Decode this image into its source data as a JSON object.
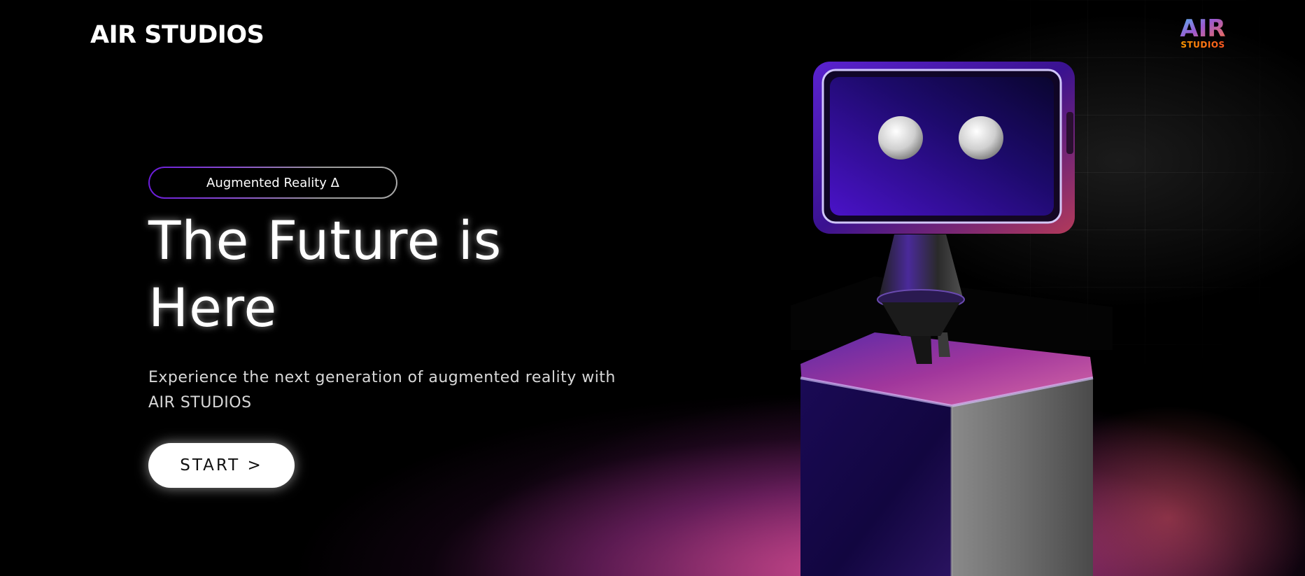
{
  "header": {
    "brand": "AIR STUDIOS",
    "logo": {
      "top_text": "AIR",
      "bottom_text": "STUDIOS"
    }
  },
  "hero": {
    "badge": "Augmented Reality Δ",
    "headline": "The Future is Here",
    "subtitle": "Experience the next generation of augmented reality with AIR STUDIOS",
    "start_button": "START  >"
  },
  "colors": {
    "background": "#000000",
    "accent_purple": "#6a1bd8",
    "glow_pink": "#e854a0",
    "text": "#ffffff"
  }
}
